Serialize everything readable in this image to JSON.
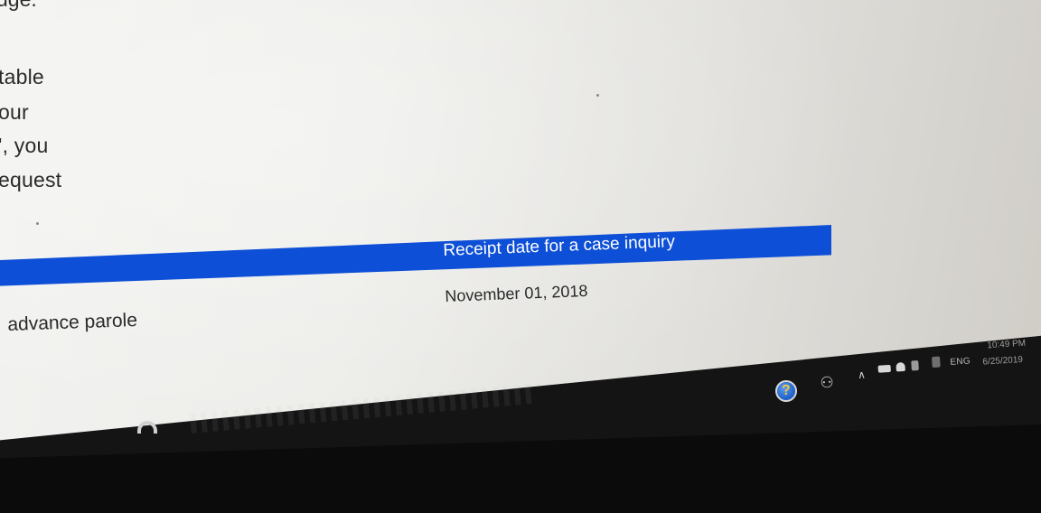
{
  "page": {
    "partial_heading": "uge.",
    "paragraph_lines": [
      "table",
      "our",
      "', you",
      "equest"
    ]
  },
  "table": {
    "header_label": "Receipt date for a case inquiry",
    "row": {
      "label": "advance parole",
      "date": "November 01, 2018"
    }
  },
  "taskbar": {
    "tray": {
      "help_icon": "help-question-icon",
      "people_icon": "people-icon",
      "overflow_icon": "chevron-up-icon",
      "language": "ENG",
      "time": "10:49 PM",
      "date": "6/25/2019"
    }
  },
  "colors": {
    "header_blue": "#0d4fd6",
    "page_bg": "#ededea",
    "taskbar_bg": "#141414"
  }
}
